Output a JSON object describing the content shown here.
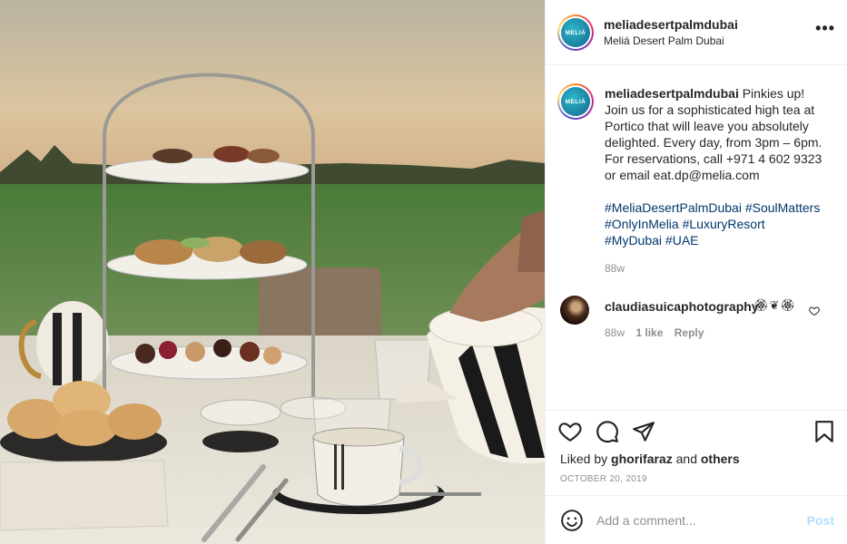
{
  "post": {
    "username": "meliadesertpalmdubai",
    "location": "Meliá Desert Palm Dubai",
    "avatar_text": "MELIÁ",
    "more_label": "•••",
    "caption_lines": [
      "Pinkies up!",
      "Join us for a sophisticated high tea at",
      "Portico that will leave you absolutely",
      "delighted. Every day, from 3pm – 6pm.",
      "For reservations, call +971 4 602 9323",
      "or email eat.dp@melia.com"
    ],
    "hashtag_lines": [
      "#MeliaDesertPalmDubai #SoulMatters",
      "#OnlyInMelia #LuxuryResort",
      "#MyDubai #UAE"
    ],
    "caption_age": "88w"
  },
  "comment": {
    "username": "claudiasuicaphotography",
    "text": "🏵❦🏵",
    "age": "88w",
    "likes": "1 like",
    "reply": "Reply"
  },
  "actions": {
    "liked_by_prefix": "Liked by",
    "liked_by_user": "ghorifaraz",
    "liked_by_and": "and",
    "liked_by_others": "others",
    "date": "OCTOBER 20, 2019"
  },
  "compose": {
    "placeholder": "Add a comment...",
    "post_label": "Post"
  },
  "icons": [
    "heart-icon",
    "comment-icon",
    "share-icon",
    "bookmark-icon",
    "smile-icon",
    "more-icon"
  ]
}
